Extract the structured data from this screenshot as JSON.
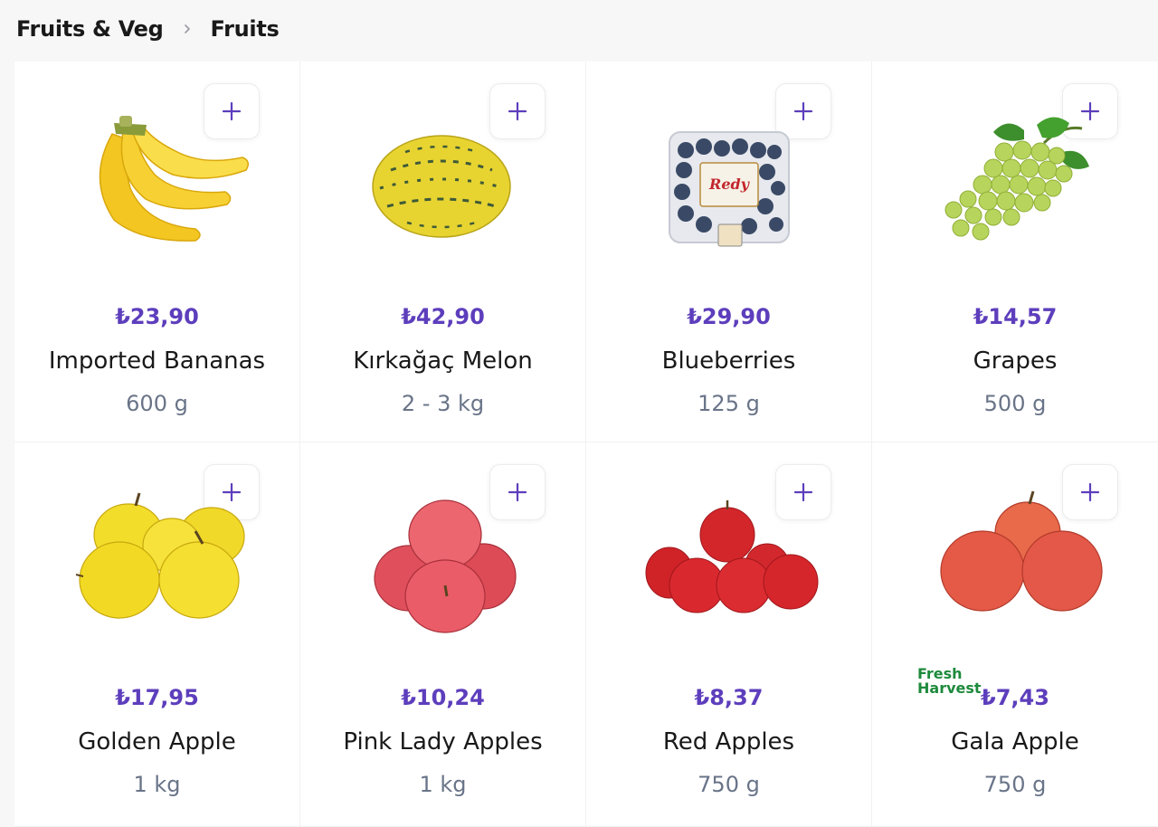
{
  "breadcrumb": {
    "parent": "Fruits & Veg",
    "current": "Fruits"
  },
  "accent_color": "#5d3ebc",
  "products": [
    {
      "price": "₺23,90",
      "name": "Imported Bananas",
      "quantity": "600 g",
      "image": "bananas"
    },
    {
      "price": "₺42,90",
      "name": "Kırkağaç Melon",
      "quantity": "2 - 3 kg",
      "image": "melon"
    },
    {
      "price": "₺29,90",
      "name": "Blueberries",
      "quantity": "125 g",
      "image": "blueberries",
      "package_label": "Redy"
    },
    {
      "price": "₺14,57",
      "name": "Grapes",
      "quantity": "500 g",
      "image": "grapes"
    },
    {
      "price": "₺17,95",
      "name": "Golden Apple",
      "quantity": "1 kg",
      "image": "golden-apples"
    },
    {
      "price": "₺10,24",
      "name": "Pink Lady Apples",
      "quantity": "1 kg",
      "image": "pink-lady-apples"
    },
    {
      "price": "₺8,37",
      "name": "Red Apples",
      "quantity": "750 g",
      "image": "red-apples"
    },
    {
      "price": "₺7,43",
      "name": "Gala Apple",
      "quantity": "750 g",
      "image": "gala-apples",
      "brand_line1": "Fresh",
      "brand_line2": "Harvest"
    }
  ]
}
